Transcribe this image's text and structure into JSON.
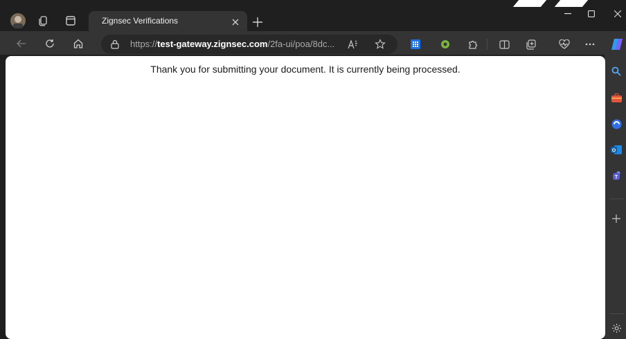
{
  "tab": {
    "title": "Zignsec Verifications",
    "close_icon": "close-icon"
  },
  "address_bar": {
    "scheme": "https://",
    "host": "test-gateway.zignsec.com",
    "path": "/2fa-ui/poa/8dc..."
  },
  "page": {
    "message": "Thank you for submitting your document. It is currently being processed."
  },
  "colors": {
    "accent": "#0f6cbd",
    "content_bg": "#ffffff",
    "chrome_bg": "#1f1f1f"
  }
}
